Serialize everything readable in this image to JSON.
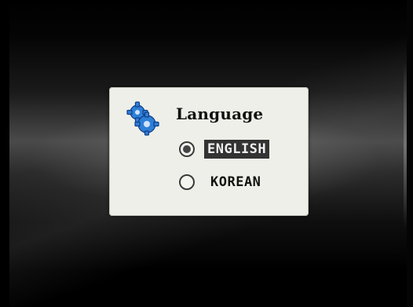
{
  "dialog": {
    "title": "Language",
    "icon": "gear-icon",
    "options": [
      {
        "label": "ENGLISH",
        "selected": true
      },
      {
        "label": "KOREAN",
        "selected": false
      }
    ]
  },
  "colors": {
    "dialog_bg": "#efefe9",
    "gear_blue": "#2f7fd6",
    "selected_bg": "#333333"
  }
}
